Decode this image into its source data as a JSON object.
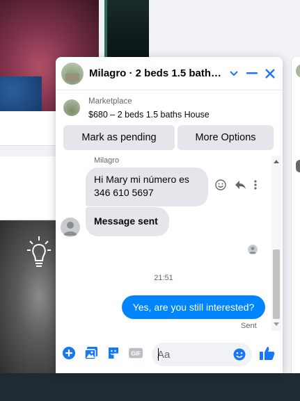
{
  "chat": {
    "title": "Milagro · 2 beds 1.5 baths ...",
    "listing": {
      "source": "Marketplace",
      "title": "$680 – 2 beds 1.5 baths House"
    },
    "actions": {
      "mark_pending": "Mark as pending",
      "more_options": "More Options"
    },
    "messages": {
      "sender_name": "Milagro",
      "incoming": [
        {
          "text": "Hi Mary mi número es 346 610 5697"
        },
        {
          "text": "Message sent"
        }
      ],
      "timestamp": "21:51",
      "outgoing": {
        "text": "Yes, are you still interested?",
        "status": "Sent"
      }
    },
    "composer": {
      "placeholder": "Aa",
      "icons": [
        "plus-icon",
        "photo-icon",
        "sticker-icon",
        "gif-icon",
        "emoji-icon",
        "like-icon"
      ]
    },
    "accent_color": "#1877f2",
    "outgoing_bubble_color": "#0084ff"
  }
}
